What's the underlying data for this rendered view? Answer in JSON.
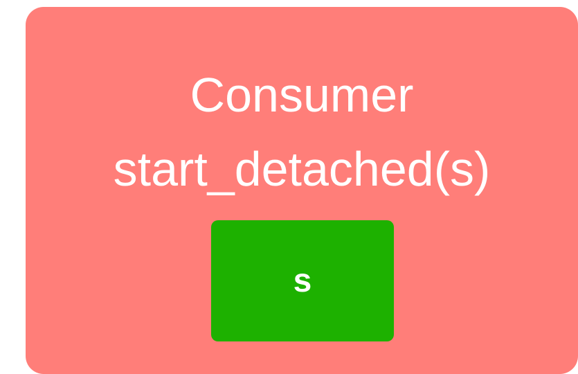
{
  "colors": {
    "consumer_fill": "#ff7e79",
    "sender_fill": "#1db100",
    "text": "#ffffff"
  },
  "consumer": {
    "title_line1": "Consumer",
    "title_line2": "start_detached(s)"
  },
  "sender": {
    "label": "s"
  }
}
